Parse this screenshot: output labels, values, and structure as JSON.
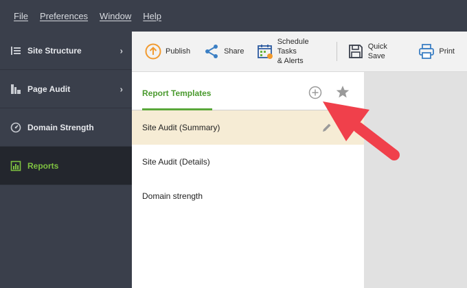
{
  "menu": {
    "items": [
      {
        "label": "File"
      },
      {
        "label": "Preferences"
      },
      {
        "label": "Window"
      },
      {
        "label": "Help"
      }
    ]
  },
  "sidebar": {
    "items": [
      {
        "label": "Site Structure",
        "icon": "site-structure-icon"
      },
      {
        "label": "Page Audit",
        "icon": "page-audit-icon"
      },
      {
        "label": "Domain Strength",
        "icon": "gauge-icon"
      },
      {
        "label": "Reports",
        "icon": "reports-icon"
      }
    ],
    "active_color": "#7fc241"
  },
  "toolbar": {
    "publish_label": "Publish",
    "share_label": "Share",
    "schedule_line1": "Schedule Tasks",
    "schedule_line2": "& Alerts",
    "quicksave_label": "Quick Save",
    "print_label": "Print"
  },
  "panel": {
    "title": "Report Templates",
    "rows": [
      {
        "label": "Site Audit (Summary)"
      },
      {
        "label": "Site Audit (Details)"
      },
      {
        "label": "Domain strength"
      }
    ]
  },
  "colors": {
    "accent_green": "#4a9a2e",
    "annotation_arrow": "#f0404b",
    "publish_orange": "#f29a2e",
    "share_blue": "#3b7fc4"
  }
}
